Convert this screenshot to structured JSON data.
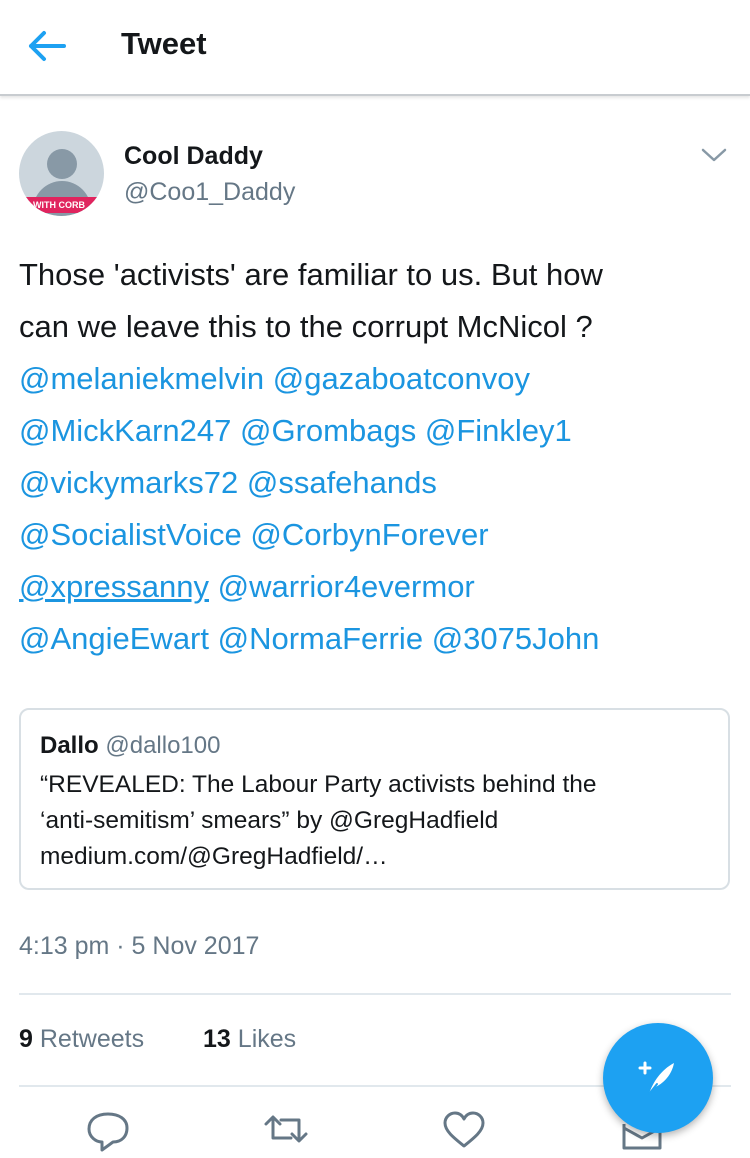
{
  "header": {
    "title": "Tweet",
    "back_icon": "arrow-left-icon"
  },
  "tweet": {
    "display_name": "Cool Daddy",
    "handle": "@Coo1_Daddy",
    "avatar_banner_text": "WITH CORB",
    "text_line1": "Those 'activists' are familiar to us. But how",
    "text_line2": "can we leave this to the corrupt McNicol ?",
    "mentions": [
      "@melaniekmelvin",
      "@gazaboatconvoy",
      "@MickKarn247",
      "@Grombags",
      "@Finkley1",
      "@vickymarks72",
      "@ssafehands",
      "@SocialistVoice",
      "@CorbynForever",
      "@xpressanny",
      "@warrior4evermor",
      "@AngieEwart",
      "@NormaFerrie",
      "@3075John"
    ],
    "timestamp": "4:13 pm · 5 Nov 2017"
  },
  "quote": {
    "name": "Dallo",
    "handle": "@dallo100",
    "line1": "“REVEALED: The Labour Party activists behind the",
    "line2": "‘anti-semitism’ smears” by @GregHadfield",
    "line3": "medium.com/@GregHadfield/…"
  },
  "stats": {
    "retweets_count": "9",
    "retweets_label": "Retweets",
    "likes_count": "13",
    "likes_label": "Likes"
  },
  "actions": [
    "reply-icon",
    "retweet-icon",
    "like-icon",
    "share-icon"
  ],
  "fab": {
    "icon": "compose-tweet-icon"
  },
  "colors": {
    "accent": "#1da1f2",
    "link": "#1b95e0",
    "text": "#14171a",
    "secondary": "#657786",
    "border": "#e1e8ed"
  }
}
